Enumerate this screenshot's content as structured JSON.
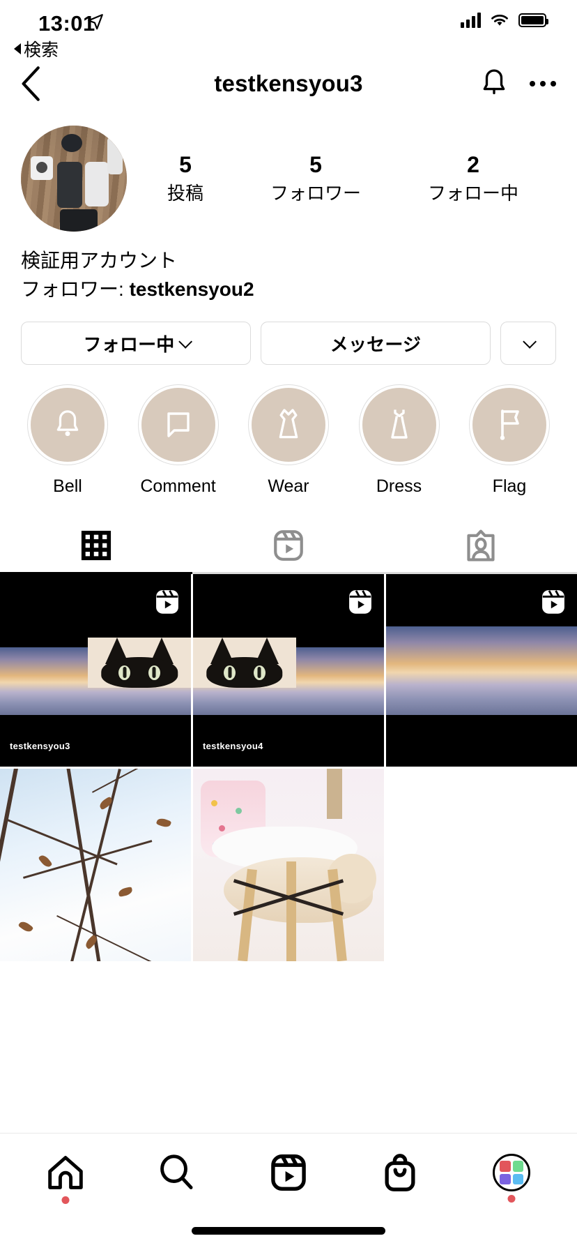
{
  "status_bar": {
    "time": "13:01",
    "location_icon": "location-arrow-icon",
    "back_label": "検索",
    "signal_icon": "cellular-signal-icon",
    "wifi_icon": "wifi-icon",
    "battery_icon": "battery-full-icon"
  },
  "nav": {
    "back_icon": "chevron-left-icon",
    "title": "testkensyou3",
    "bell_icon": "bell-icon",
    "more_icon": "more-options-icon"
  },
  "profile": {
    "avatar_alt": "profile-avatar",
    "stats": [
      {
        "num": "5",
        "label": "投稿"
      },
      {
        "num": "5",
        "label": "フォロワー"
      },
      {
        "num": "2",
        "label": "フォロー中"
      }
    ],
    "display_name": "検証用アカウント",
    "bio_prefix": "フォロワー: ",
    "bio_mention": "testkensyou2"
  },
  "actions": {
    "follow_label": "フォロー中",
    "message_label": "メッセージ",
    "more_icon": "chevron-down-icon"
  },
  "highlights": [
    {
      "label": "Bell",
      "icon": "bell-icon"
    },
    {
      "label": "Comment",
      "icon": "comment-icon"
    },
    {
      "label": "Wear",
      "icon": "dress-icon"
    },
    {
      "label": "Dress",
      "icon": "dress-icon"
    },
    {
      "label": "Flag",
      "icon": "flag-icon"
    }
  ],
  "tabs": [
    {
      "name": "grid",
      "icon": "grid-icon",
      "active": true
    },
    {
      "name": "reels",
      "icon": "reels-icon",
      "active": false
    },
    {
      "name": "tagged",
      "icon": "tagged-icon",
      "active": false
    }
  ],
  "grid": {
    "items": [
      {
        "type": "reel",
        "badge": "reels-icon",
        "watermark": "testkensyou3",
        "art": "sunset-cat"
      },
      {
        "type": "reel",
        "badge": "reels-icon",
        "watermark": "testkensyou4",
        "art": "sunset-cat"
      },
      {
        "type": "reel",
        "badge": "reels-icon",
        "watermark": "",
        "art": "sunset"
      },
      {
        "type": "photo",
        "badge": "",
        "watermark": "",
        "art": "branches"
      },
      {
        "type": "photo",
        "badge": "",
        "watermark": "",
        "art": "cat-chair"
      },
      {
        "type": "empty",
        "badge": "",
        "watermark": "",
        "art": "none"
      }
    ]
  },
  "bottom_nav": {
    "items": [
      {
        "name": "home",
        "icon": "home-icon",
        "badge_dot": true
      },
      {
        "name": "search",
        "icon": "search-icon",
        "badge_dot": false
      },
      {
        "name": "reels",
        "icon": "reels-icon",
        "badge_dot": false
      },
      {
        "name": "shop",
        "icon": "shop-bag-icon",
        "badge_dot": false
      },
      {
        "name": "profile",
        "icon": "profile-avatar-icon",
        "badge_dot": true
      }
    ],
    "avatar_colors": [
      "#e2565b",
      "#6fdb8f",
      "#7b63e0",
      "#5bbcf2"
    ]
  },
  "colors": {
    "highlight_fill": "#d8cabc",
    "border": "#dbdbdb",
    "accent_dot": "#e2565b"
  }
}
